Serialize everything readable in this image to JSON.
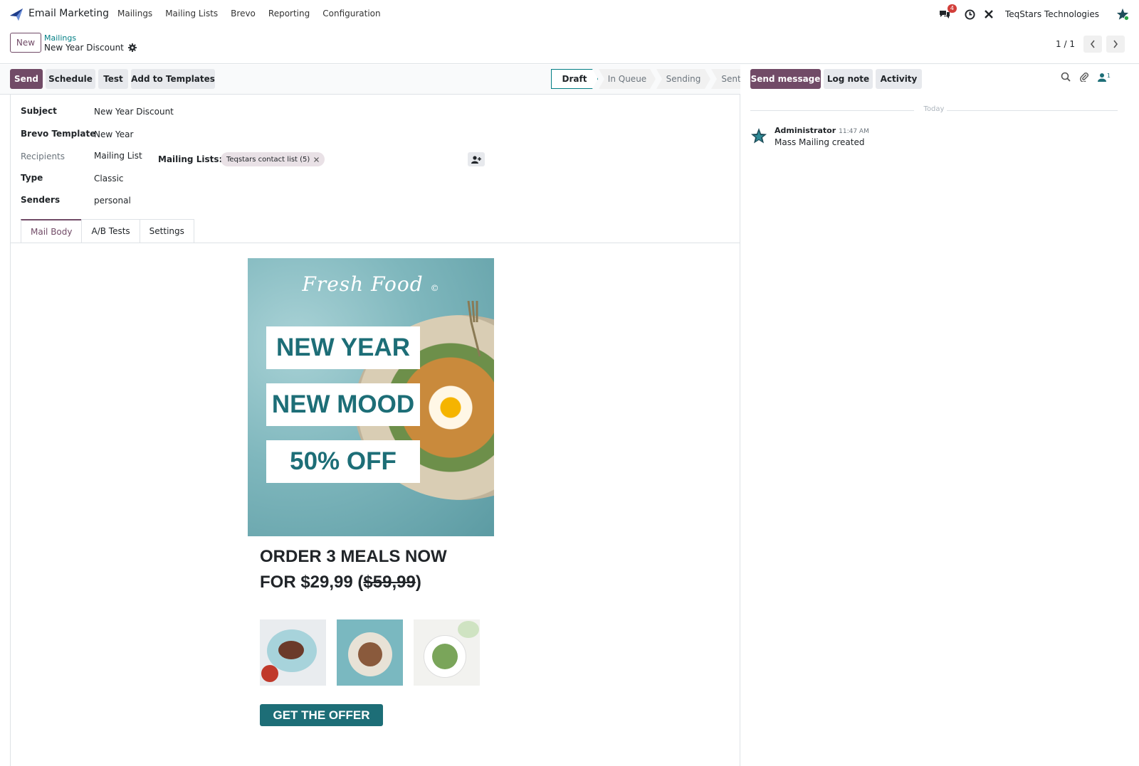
{
  "navbar": {
    "app_name": "Email Marketing",
    "menu": [
      "Mailings",
      "Mailing Lists",
      "Brevo",
      "Reporting",
      "Configuration"
    ],
    "messages_badge": "4",
    "company": "TeqStars Technologies"
  },
  "control_panel": {
    "new_label": "New",
    "breadcrumb_parent": "Mailings",
    "breadcrumb_current": "New Year Discount",
    "pager": "1 / 1"
  },
  "statusbar": {
    "buttons": [
      "Send",
      "Schedule",
      "Test",
      "Add to Templates"
    ],
    "stages": [
      "Draft",
      "In Queue",
      "Sending",
      "Sent"
    ],
    "active_stage": "Draft"
  },
  "form": {
    "subject_label": "Subject",
    "subject_value": "New Year Discount",
    "template_label": "Brevo Template",
    "template_value": "New Year",
    "recipients_label": "Recipients",
    "recipients_value": "Mailing List",
    "mailing_lists_label": "Mailing Lists:",
    "mailing_list_tag": "Teqstars contact list (5)",
    "type_label": "Type",
    "type_value": "Classic",
    "senders_label": "Senders",
    "senders_value": "personal",
    "tabs": [
      "Mail Body",
      "A/B Tests",
      "Settings"
    ],
    "active_tab": "Mail Body"
  },
  "email": {
    "brand": "Fresh Food",
    "brand_mark": "©",
    "headline_1": "NEW YEAR",
    "headline_2": "NEW MOOD",
    "headline_3": "50% OFF",
    "offer_line_1": "ORDER 3 MEALS NOW",
    "offer_line_2_prefix": "FOR $29,99 (",
    "offer_old_price": "$59,99",
    "offer_line_2_suffix": ")",
    "cta": "GET THE OFFER",
    "accent_color": "#1d6e77"
  },
  "chatter": {
    "buttons": [
      "Send message",
      "Log note",
      "Activity"
    ],
    "followers_count": "1",
    "date_separator": "Today",
    "messages": [
      {
        "author": "Administrator",
        "time": "11:47 AM",
        "body": "Mass Mailing created"
      }
    ]
  },
  "colors": {
    "primary": "#714b67",
    "link": "#017e84"
  }
}
